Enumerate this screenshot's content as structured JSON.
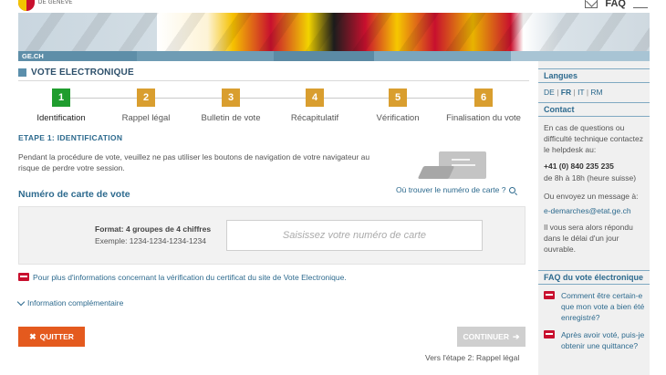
{
  "header": {
    "crest_text": "DE GENEVE",
    "faq_label": "FAQ"
  },
  "banner": {
    "site_label": "GE.CH"
  },
  "section": {
    "title": "VOTE ELECTRONIQUE"
  },
  "steps": [
    {
      "number": "1",
      "label": "Identification",
      "state": "active"
    },
    {
      "number": "2",
      "label": "Rappel légal",
      "state": "pending"
    },
    {
      "number": "3",
      "label": "Bulletin de vote",
      "state": "pending"
    },
    {
      "number": "4",
      "label": "Récapitulatif",
      "state": "pending"
    },
    {
      "number": "5",
      "label": "Vérification",
      "state": "pending"
    },
    {
      "number": "6",
      "label": "Finalisation du vote",
      "state": "pending"
    }
  ],
  "etape": {
    "title": "ETAPE 1: IDENTIFICATION",
    "notice": "Pendant la procédure de vote, veuillez ne pas utiliser les boutons de navigation de votre navigateur au risque de perdre votre session."
  },
  "card": {
    "title": "Numéro de carte de vote",
    "where_link": "Où trouver le numéro de carte ?",
    "format": "Format: 4 groupes de 4 chiffres",
    "example": "Exemple: 1234-1234-1234-1234",
    "input_value": "",
    "input_placeholder": "Saisissez votre numéro de carte"
  },
  "links": {
    "certificate": "Pour plus d'informations concernant la vérification du certificat du site de Vote Electronique.",
    "more_info": "Information complémentaire"
  },
  "buttons": {
    "quit": "QUITTER",
    "continue": "CONTINUER",
    "next_step": "Vers l'étape 2: Rappel légal"
  },
  "sidebar": {
    "languages_title": "Langues",
    "languages": [
      "DE",
      "FR",
      "IT",
      "RM"
    ],
    "active_language": "FR",
    "contact_title": "Contact",
    "contact_text": "En cas de questions ou difficulté technique contactez le helpdesk au:",
    "phone": "+41 (0) 840 235 235",
    "hours": "de 8h à 18h (heure suisse)",
    "email_intro": "Ou envoyez un message à:",
    "email": "e-demarches@etat.ge.ch",
    "reply_text": "Il vous sera alors répondu dans le délai d'un jour ouvrable.",
    "faq_title": "FAQ du vote électronique",
    "faq_items": [
      "Comment être certain-e que mon vote a bien été enregistré?",
      "Après avoir voté, puis-je obtenir une quittance?"
    ]
  },
  "colors": {
    "accent_blue": "#2d6a8e",
    "step_active": "#1f9d2e",
    "step_pending": "#d99e2f",
    "quit_button": "#e45a1e",
    "continue_disabled": "#cfcfcf"
  }
}
